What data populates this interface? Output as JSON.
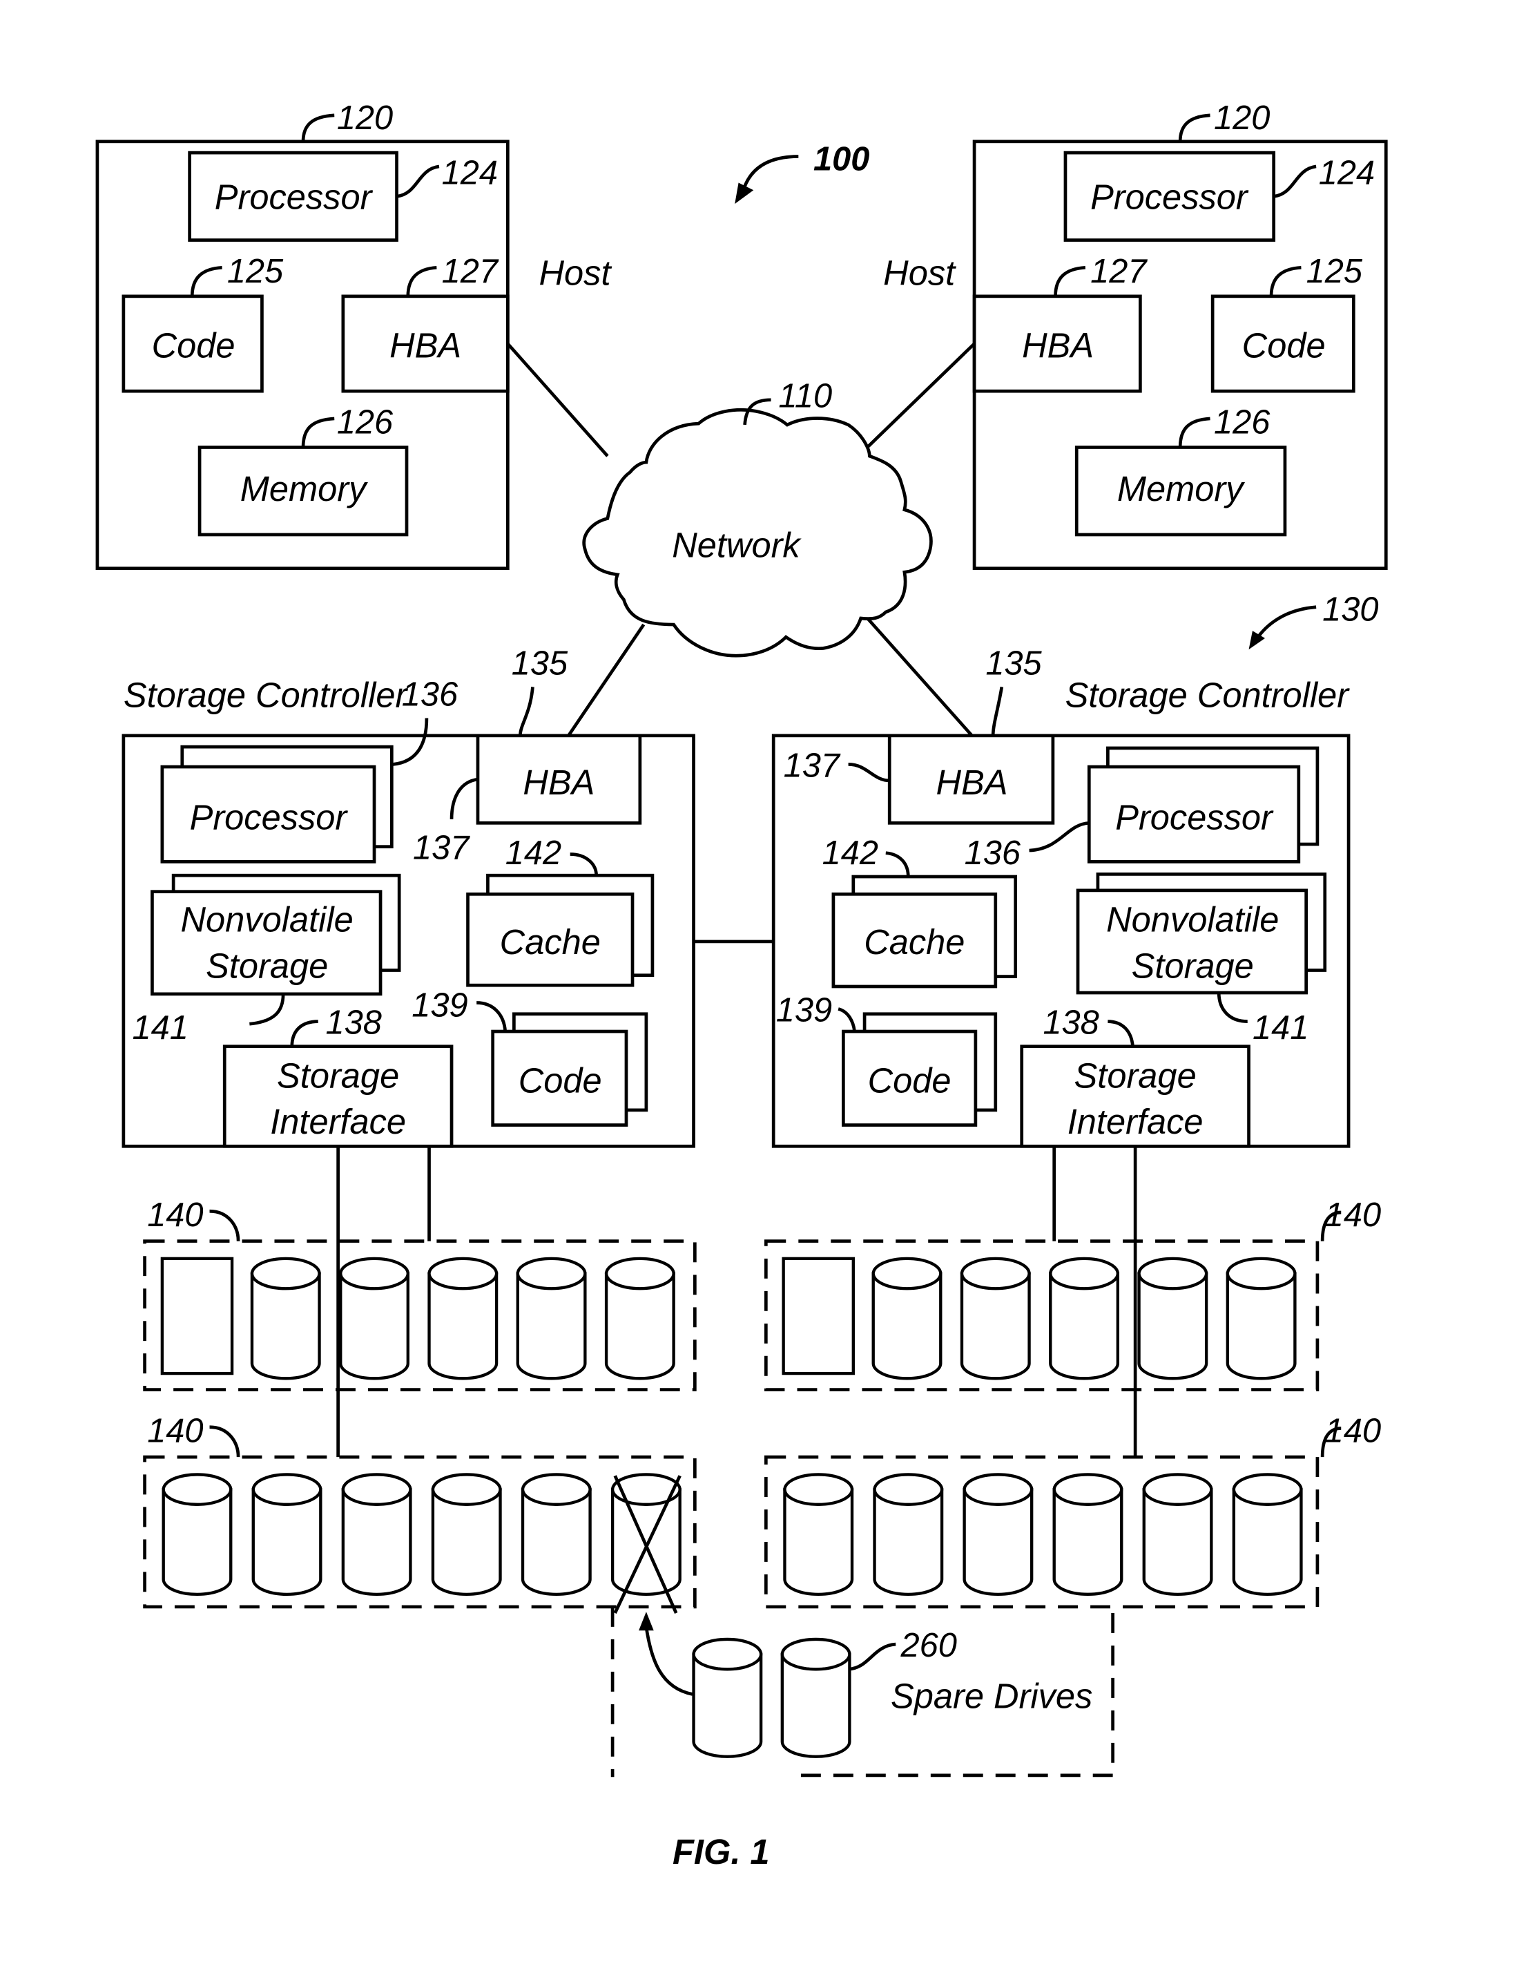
{
  "figure": {
    "caption": "FIG. 1",
    "system_ref": "100",
    "controller_group_ref": "130"
  },
  "hosts": [
    {
      "side": "left",
      "ref": "120",
      "label": "Host",
      "processor": {
        "label": "Processor",
        "ref": "124"
      },
      "code": {
        "label": "Code",
        "ref": "125"
      },
      "hba": {
        "label": "HBA",
        "ref": "127"
      },
      "memory": {
        "label": "Memory",
        "ref": "126"
      }
    },
    {
      "side": "right",
      "ref": "120",
      "label": "Host",
      "processor": {
        "label": "Processor",
        "ref": "124"
      },
      "code": {
        "label": "Code",
        "ref": "125"
      },
      "hba": {
        "label": "HBA",
        "ref": "127"
      },
      "memory": {
        "label": "Memory",
        "ref": "126"
      }
    }
  ],
  "network": {
    "label": "Network",
    "ref": "110"
  },
  "controllers": [
    {
      "side": "left",
      "label": "Storage Controller",
      "hba": {
        "label": "HBA",
        "ref": "135",
        "port_ref": "137"
      },
      "processor": {
        "label": "Processor",
        "ref": "136"
      },
      "nonvolatile": {
        "line1": "Nonvolatile",
        "line2": "Storage",
        "ref": "141"
      },
      "cache": {
        "label": "Cache",
        "ref": "142"
      },
      "code": {
        "label": "Code",
        "ref": "139"
      },
      "storage_interface": {
        "line1": "Storage",
        "line2": "Interface",
        "ref": "138"
      }
    },
    {
      "side": "right",
      "label": "Storage Controller",
      "hba": {
        "label": "HBA",
        "ref": "135",
        "port_ref": "137"
      },
      "processor": {
        "label": "Processor",
        "ref": "136"
      },
      "nonvolatile": {
        "line1": "Nonvolatile",
        "line2": "Storage",
        "ref": "141"
      },
      "cache": {
        "label": "Cache",
        "ref": "142"
      },
      "code": {
        "label": "Code",
        "ref": "139"
      },
      "storage_interface": {
        "line1": "Storage",
        "line2": "Interface",
        "ref": "138"
      }
    }
  ],
  "enclosures": [
    {
      "position": "top-left",
      "ref": "140",
      "slots": [
        "ssd",
        "disk",
        "disk",
        "disk",
        "disk",
        "disk"
      ]
    },
    {
      "position": "top-right",
      "ref": "140",
      "slots": [
        "ssd",
        "disk",
        "disk",
        "disk",
        "disk",
        "disk"
      ]
    },
    {
      "position": "bottom-left",
      "ref": "140",
      "slots": [
        "disk",
        "disk",
        "disk",
        "disk",
        "disk",
        "failed-disk"
      ]
    },
    {
      "position": "bottom-right",
      "ref": "140",
      "slots": [
        "disk",
        "disk",
        "disk",
        "disk",
        "disk",
        "disk"
      ]
    }
  ],
  "spares": {
    "ref": "260",
    "label": "Spare Drives",
    "count": 2
  }
}
